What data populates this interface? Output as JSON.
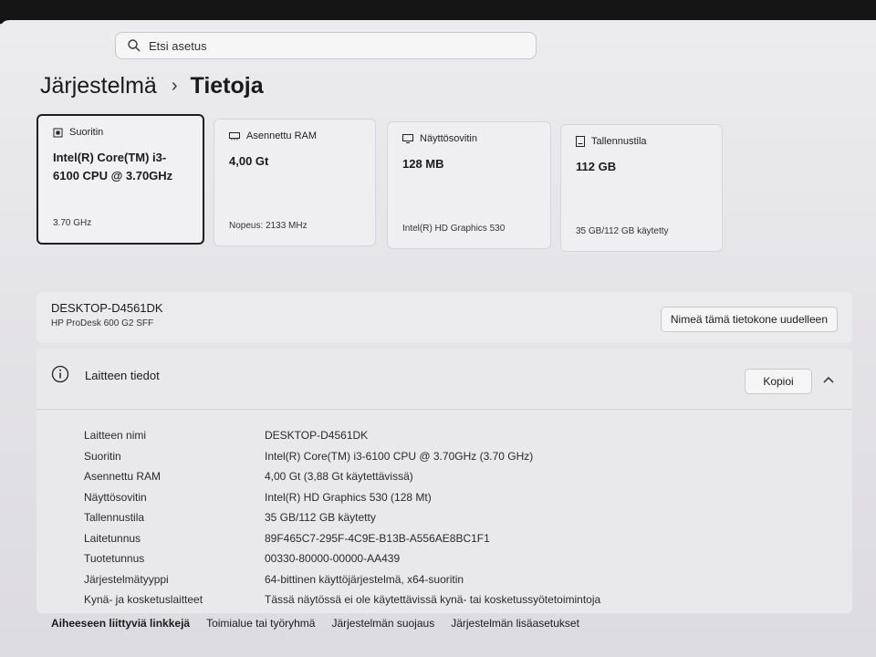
{
  "search": {
    "placeholder": "Etsi asetus"
  },
  "breadcrumb": {
    "parent": "Järjestelmä",
    "separator": "›",
    "current": "Tietoja"
  },
  "cards": [
    {
      "icon": "processor-icon",
      "title": "Suoritin",
      "value": "Intel(R) Core(TM) i3-6100 CPU @ 3.70GHz",
      "sub": "3.70 GHz"
    },
    {
      "icon": "ram-icon",
      "title": "Asennettu RAM",
      "value": "4,00 Gt",
      "sub": "Nopeus: 2133 MHz"
    },
    {
      "icon": "display-adapter-icon",
      "title": "Näyttösovitin",
      "value": "128 MB",
      "sub": "Intel(R) HD Graphics 530"
    },
    {
      "icon": "storage-icon",
      "title": "Tallennustila",
      "value": "112 GB",
      "sub": "35 GB/112 GB käytetty"
    }
  ],
  "device": {
    "name": "DESKTOP-D4561DK",
    "model": "HP ProDesk 600 G2 SFF",
    "rename_label": "Nimeä tämä tietokone uudelleen"
  },
  "specs": {
    "title": "Laitteen tiedot",
    "copy_label": "Kopioi",
    "rows": [
      {
        "key": "Laitteen nimi",
        "value": "DESKTOP-D4561DK"
      },
      {
        "key": "Suoritin",
        "value": "Intel(R) Core(TM) i3-6100 CPU @ 3.70GHz (3.70 GHz)"
      },
      {
        "key": "Asennettu RAM",
        "value": "4,00 Gt (3,88 Gt käytettävissä)"
      },
      {
        "key": "Näyttösovitin",
        "value": "Intel(R) HD Graphics 530 (128 Mt)"
      },
      {
        "key": "Tallennustila",
        "value": "35 GB/112 GB käytetty"
      },
      {
        "key": "Laitetunnus",
        "value": "89F465C7-295F-4C9E-B13B-A556AE8BC1F1"
      },
      {
        "key": "Tuotetunnus",
        "value": "00330-80000-00000-AA439"
      },
      {
        "key": "Järjestelmätyyppi",
        "value": "64-bittinen käyttöjärjestelmä, x64-suoritin"
      },
      {
        "key": "Kynä- ja kosketuslaitteet",
        "value": "Tässä näytössä ei ole käytettävissä kynä- tai kosketussyötetoimintoja"
      }
    ]
  },
  "footer": {
    "label": "Aiheeseen liittyviä linkkejä",
    "links": [
      "Toimialue tai työryhmä",
      "Järjestelmän suojaus",
      "Järjestelmän lisäasetukset"
    ]
  }
}
